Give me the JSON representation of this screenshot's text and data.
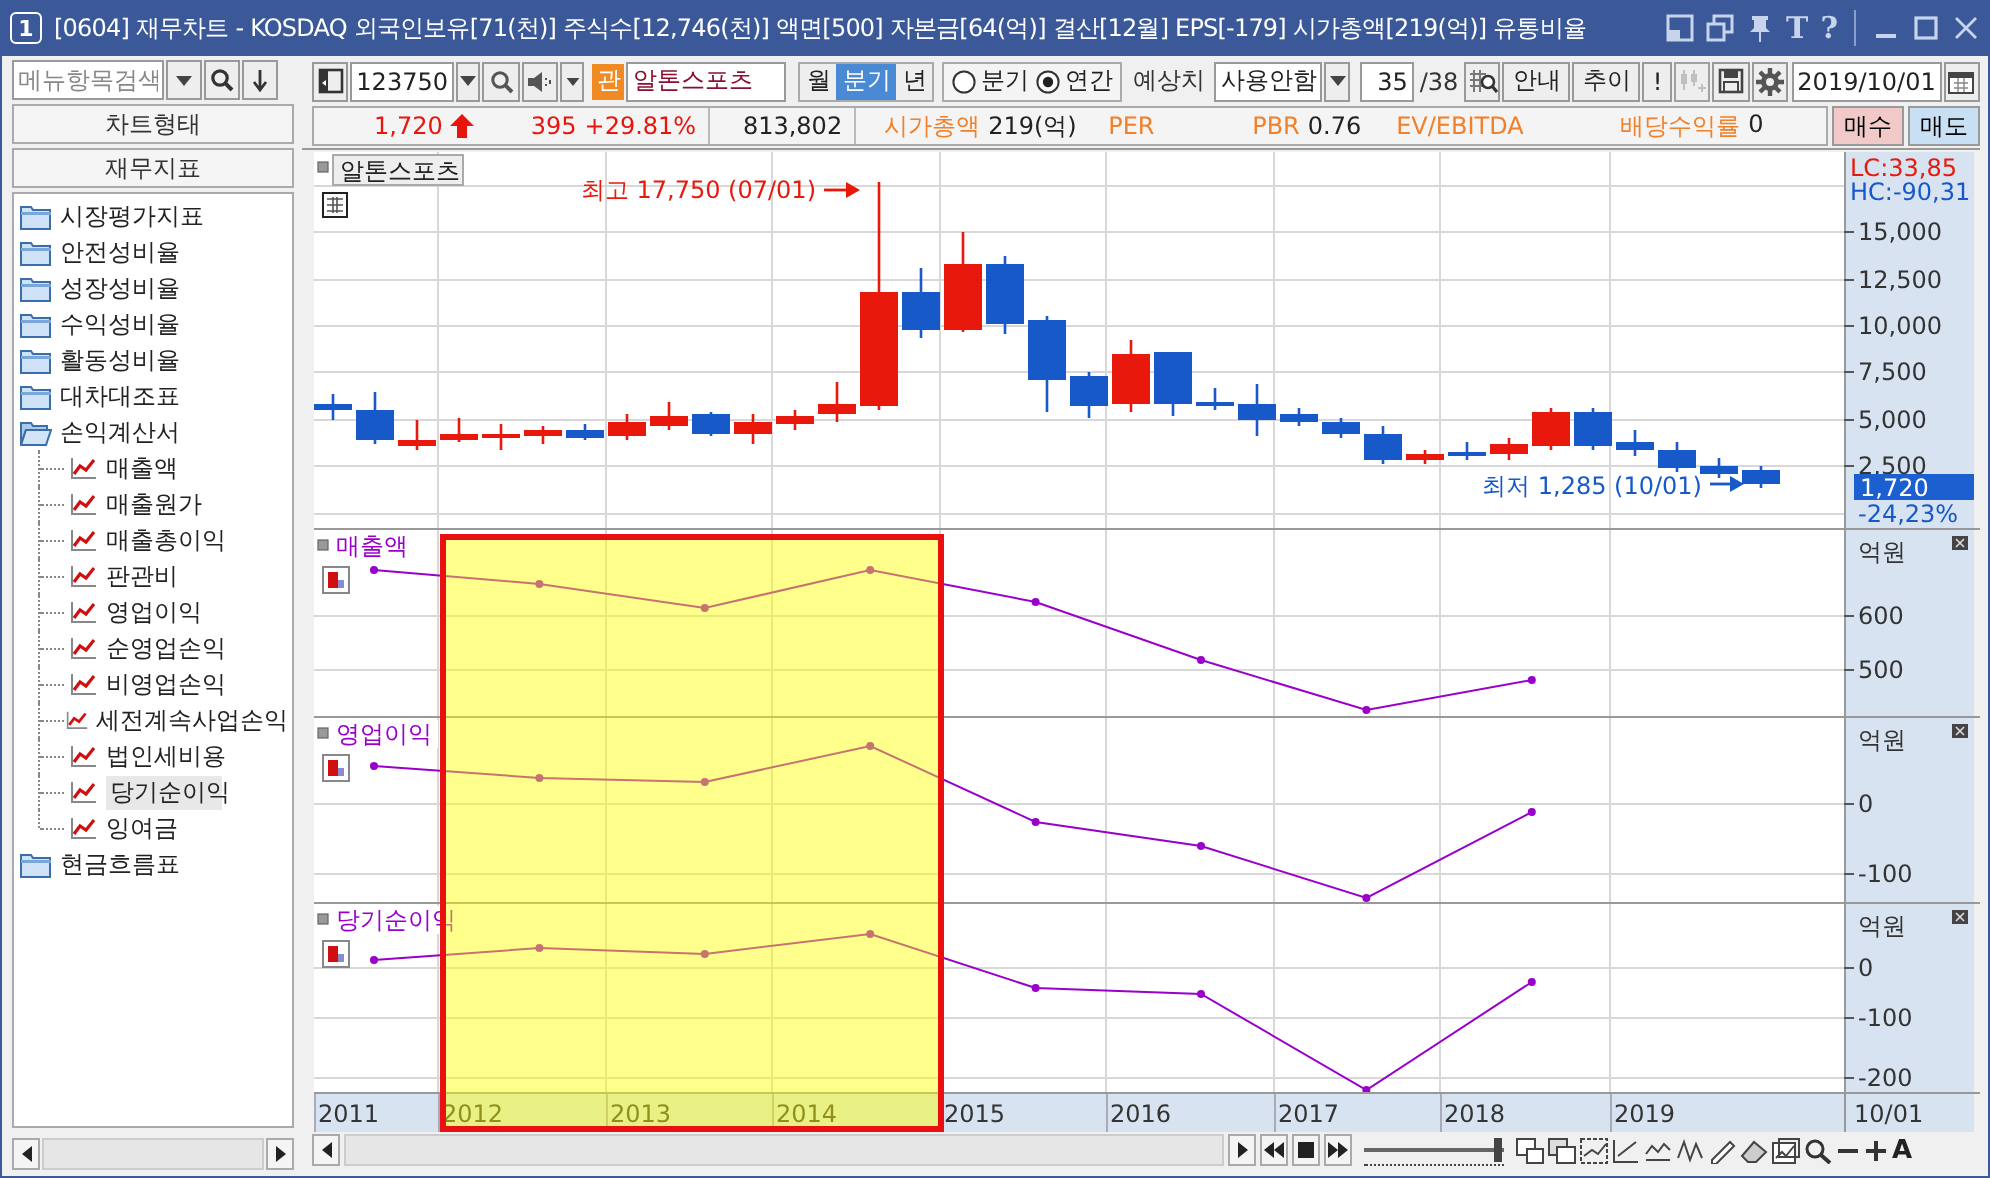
{
  "window": {
    "number": "1",
    "title": "[0604] 재무차트 - KOSDAQ 외국인보유[71(천)] 주식수[12,746(천)] 액면[500] 자본금[64(억)] 결산[12월] EPS[-179] 시가총액[219(억)] 유통비율",
    "glyph_buttons": [
      "T",
      "?"
    ]
  },
  "sidebar": {
    "search": {
      "placeholder": "메뉴항목검색"
    },
    "buttons": [
      "차트형태",
      "재무지표"
    ],
    "tree": [
      {
        "label": "시장평가지표",
        "expanded": false
      },
      {
        "label": "안전성비율",
        "expanded": false
      },
      {
        "label": "성장성비율",
        "expanded": false
      },
      {
        "label": "수익성비율",
        "expanded": false
      },
      {
        "label": "활동성비율",
        "expanded": false
      },
      {
        "label": "대차대조표",
        "expanded": false
      },
      {
        "label": "손익계산서",
        "expanded": true,
        "children": [
          {
            "label": "매출액",
            "selected": false
          },
          {
            "label": "매출원가",
            "selected": false
          },
          {
            "label": "매출총이익",
            "selected": false
          },
          {
            "label": "판관비",
            "selected": false
          },
          {
            "label": "영업이익",
            "selected": false
          },
          {
            "label": "순영업손익",
            "selected": false
          },
          {
            "label": "비영업손익",
            "selected": false
          },
          {
            "label": "세전계속사업손익",
            "selected": false
          },
          {
            "label": "법인세비용",
            "selected": false
          },
          {
            "label": "당기순이익",
            "selected": true
          },
          {
            "label": "잉여금",
            "selected": false
          }
        ]
      },
      {
        "label": "현금흐름표",
        "expanded": false
      }
    ]
  },
  "toolbar": {
    "code": "123750",
    "badge": "관",
    "name": "알톤스포츠",
    "periods": [
      {
        "label": "월",
        "selected": false
      },
      {
        "label": "분기",
        "selected": true
      },
      {
        "label": "년",
        "selected": false
      }
    ],
    "radios": [
      {
        "label": "분기",
        "selected": false
      },
      {
        "label": "연간",
        "selected": true
      }
    ],
    "estimate_label": "예상치",
    "estimate_value": "사용안함",
    "page": "35",
    "page_total": "/38",
    "buttons": [
      "안내",
      "추이",
      "!"
    ],
    "date": "2019/10/01"
  },
  "quote": {
    "price": "1,720",
    "change": "395",
    "change_pct": "+29.81%",
    "volume": "813,802",
    "stats": [
      {
        "label": "시가총액",
        "value": "219(억)"
      },
      {
        "label": "PER"
      },
      {
        "label": "PBR",
        "value": "0.76"
      },
      {
        "label": "EV/EBITDA"
      },
      {
        "label": "배당수익률",
        "value": "0"
      }
    ],
    "buy": "매수",
    "sell": "매도"
  },
  "price_chart": {
    "label": "알톤스포츠",
    "high_note": "최고 17,750 (07/01)",
    "low_note": "최저 1,285 (10/01)",
    "lc": "LC:33,85",
    "hc": "HC:-90,31",
    "ticks": [
      "15,000",
      "12,500",
      "10,000",
      "7,500",
      "5,000",
      "2,500"
    ],
    "current": "1,720",
    "change": "-24,23%"
  },
  "panels": [
    {
      "title": "매출액",
      "unit": "억원",
      "ticks": [
        "600",
        "500"
      ]
    },
    {
      "title": "영업이익",
      "unit": "억원",
      "ticks": [
        "0",
        "-100"
      ]
    },
    {
      "title": "당기순이익",
      "unit": "억원",
      "ticks": [
        "0",
        "-100",
        "-200"
      ]
    }
  ],
  "x_axis": {
    "labels": [
      "2011",
      "2012",
      "2013",
      "2014",
      "2015",
      "2016",
      "2017",
      "2018",
      "2019"
    ],
    "end_label": "10/01"
  },
  "bottom_bar": {
    "zoom_slider": {
      "level": 0.95
    },
    "glyph_buttons": [
      "A"
    ]
  }
}
